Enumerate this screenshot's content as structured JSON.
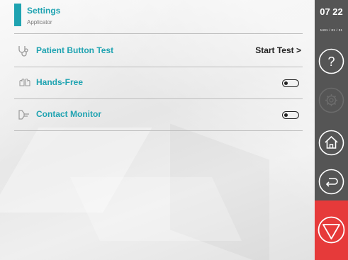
{
  "header": {
    "title": "Settings",
    "subtitle": "Applicator"
  },
  "rows": [
    {
      "label": "Patient Button Test",
      "icon": "stethoscope-icon",
      "action": "Start Test >"
    },
    {
      "label": "Hands-Free",
      "icon": "hands-icon",
      "toggle_on": false
    },
    {
      "label": "Contact Monitor",
      "icon": "contact-monitor-icon",
      "toggle_on": false
    }
  ],
  "rail": {
    "time": "07 22",
    "date": "1401 / 01 / 31",
    "buttons": [
      "help-icon",
      "settings-icon",
      "home-icon",
      "back-icon",
      "stop-icon"
    ]
  },
  "colors": {
    "accent": "#1fa3b1",
    "rail": "#555555",
    "stop": "#e63a3a"
  }
}
